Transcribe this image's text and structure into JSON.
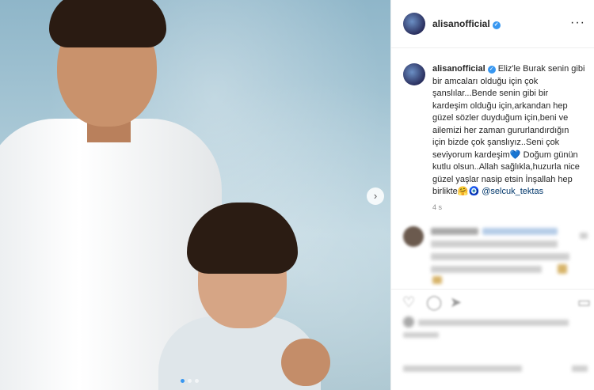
{
  "post": {
    "username": "alisanofficial",
    "verified_glyph": "✓",
    "more_glyph": "···",
    "next_glyph": "›",
    "caption": {
      "line1": "Eliz'le Burak senin gibi",
      "line2": "bir amcaları olduğu için çok",
      "line3": "şanslılar...Bende senin gibi bir",
      "line4": "kardeşim olduğu için,arkandan hep",
      "line5": "güzel sözler duyduğum için,beni ve",
      "line6": "ailemizi her zaman gururlandırdığın",
      "line7": "için bizde çok şanslıyız..Seni çok",
      "line8a": "seviyorum kardeşim",
      "heart": "💙",
      "line8b": " Doğum günün",
      "line9": "kutlu olsun..Allah sağlıkla,huzurla nice",
      "line10": "güzel yaşlar nasip etsin İnşallah hep",
      "line11a": "birlikte",
      "hug": "🤗",
      "eye": "🧿",
      "mention": " @selcuk_tektas"
    },
    "caption_meta": "4 s"
  },
  "colors": {
    "accent": "#3897f0",
    "mention": "#00376b",
    "text": "#262626"
  },
  "icons": [
    "avatar",
    "verified-icon",
    "more-icon",
    "next-arrow-icon",
    "heart-icon",
    "comment-icon",
    "share-icon",
    "bookmark-icon"
  ]
}
